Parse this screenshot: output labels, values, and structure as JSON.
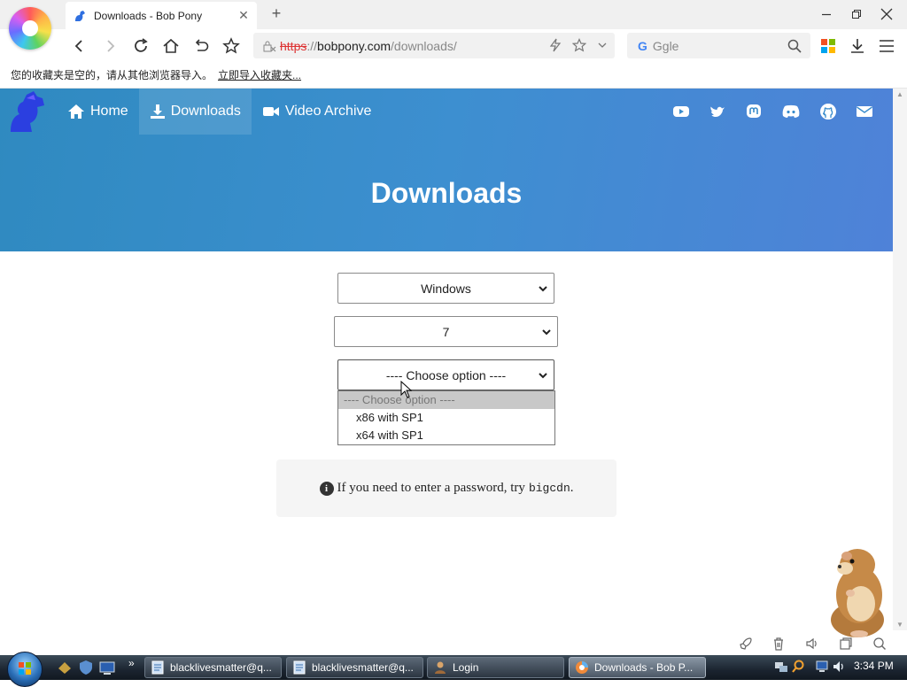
{
  "browser": {
    "tab_title": "Downloads - Bob Pony",
    "new_tab_symbol": "+",
    "url": {
      "protocol": "https",
      "separator": "://",
      "host": "bobpony.com",
      "path": "/downloads/"
    },
    "search_placeholder": "Ggle",
    "search_engine_letter": "G",
    "bookmarks_message": "您的收藏夹是空的，请从其他浏览器导入。",
    "bookmarks_import_link": "立即导入收藏夹..."
  },
  "site": {
    "nav": [
      {
        "label": "Home",
        "icon": "home-icon"
      },
      {
        "label": "Downloads",
        "icon": "download-icon",
        "active": true
      },
      {
        "label": "Video Archive",
        "icon": "video-camera-icon"
      }
    ],
    "social_icons": [
      "youtube-icon",
      "twitter-icon",
      "mastodon-icon",
      "discord-icon",
      "github-icon",
      "email-icon"
    ],
    "page_title": "Downloads"
  },
  "form": {
    "os_select": "Windows",
    "version_select": "7",
    "edition_select": "---- Choose option ----",
    "edition_options": [
      "---- Choose option ----",
      "x86 with SP1",
      "x64 with SP1"
    ]
  },
  "info": {
    "message": "If you need to enter a password, try",
    "password": "bigcdn",
    "end": "."
  },
  "taskbar": {
    "tasks": [
      {
        "label": "blacklivesmatter@q..."
      },
      {
        "label": "blacklivesmatter@q..."
      },
      {
        "label": "Login"
      },
      {
        "label": "Downloads - Bob P...",
        "active": true
      }
    ],
    "clock": "3:34 PM"
  },
  "colors": {
    "hero_start": "#2f8ac0",
    "hero_end": "#4f82d8",
    "url_protocol": "#dd3333"
  }
}
